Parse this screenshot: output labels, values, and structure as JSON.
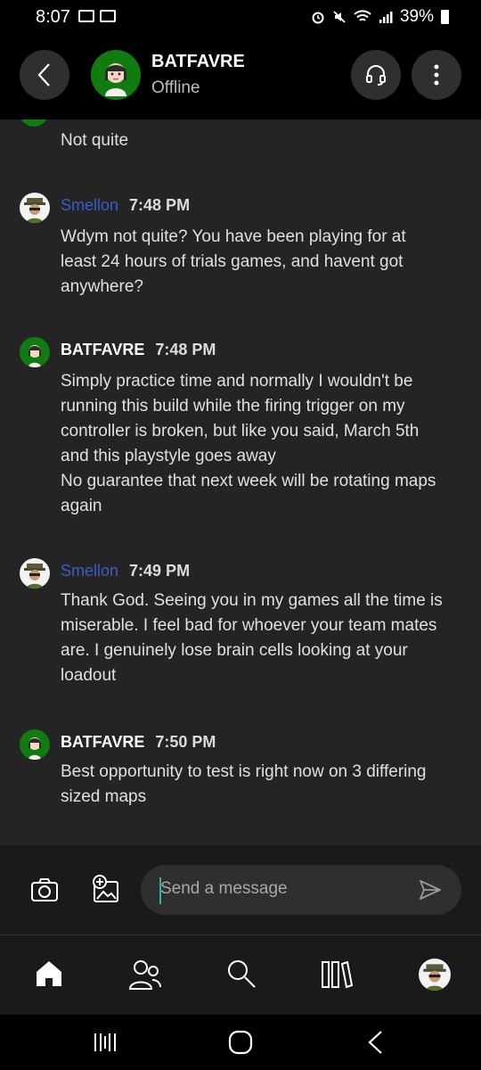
{
  "status_bar": {
    "time": "8:07",
    "battery": "39%"
  },
  "header": {
    "contact_name": "BATFAVRE",
    "contact_status": "Offline",
    "icons": [
      "back-icon",
      "headset-icon",
      "more-vertical-icon"
    ]
  },
  "chat": {
    "partial_message": "Not quite",
    "messages": [
      {
        "sender": "Smellon",
        "time": "7:48 PM",
        "lines": [
          "Wdym not quite? You have been playing for at",
          "least 24 hours of trials games, and havent got",
          "anywhere?"
        ]
      },
      {
        "sender": "BATFAVRE",
        "time": "7:48 PM",
        "lines": [
          "Simply practice time and normally I wouldn't be",
          "running this build while the firing trigger on my",
          "controller is broken, but like you said, March 5th",
          "and this playstyle goes away",
          "No guarantee that next week will be rotating maps",
          "again"
        ]
      },
      {
        "sender": "Smellon",
        "time": "7:49 PM",
        "lines": [
          "Thank God. Seeing you in my games all the time is",
          "miserable. I feel bad for whoever your team mates",
          "are. I genuinely lose brain cells looking at your",
          "loadout"
        ]
      },
      {
        "sender": "BATFAVRE",
        "time": "7:50 PM",
        "lines": [
          "Best opportunity to test is right now on 3 differing",
          "sized maps"
        ]
      }
    ]
  },
  "composer": {
    "placeholder": "Send a message"
  },
  "bottom_nav": [
    "home-icon",
    "people-icon",
    "search-icon",
    "library-icon",
    "profile-avatar"
  ],
  "colors": {
    "xbox_green": "#107c10",
    "link_blue": "#3a5cc9",
    "chat_bg": "#242424"
  }
}
